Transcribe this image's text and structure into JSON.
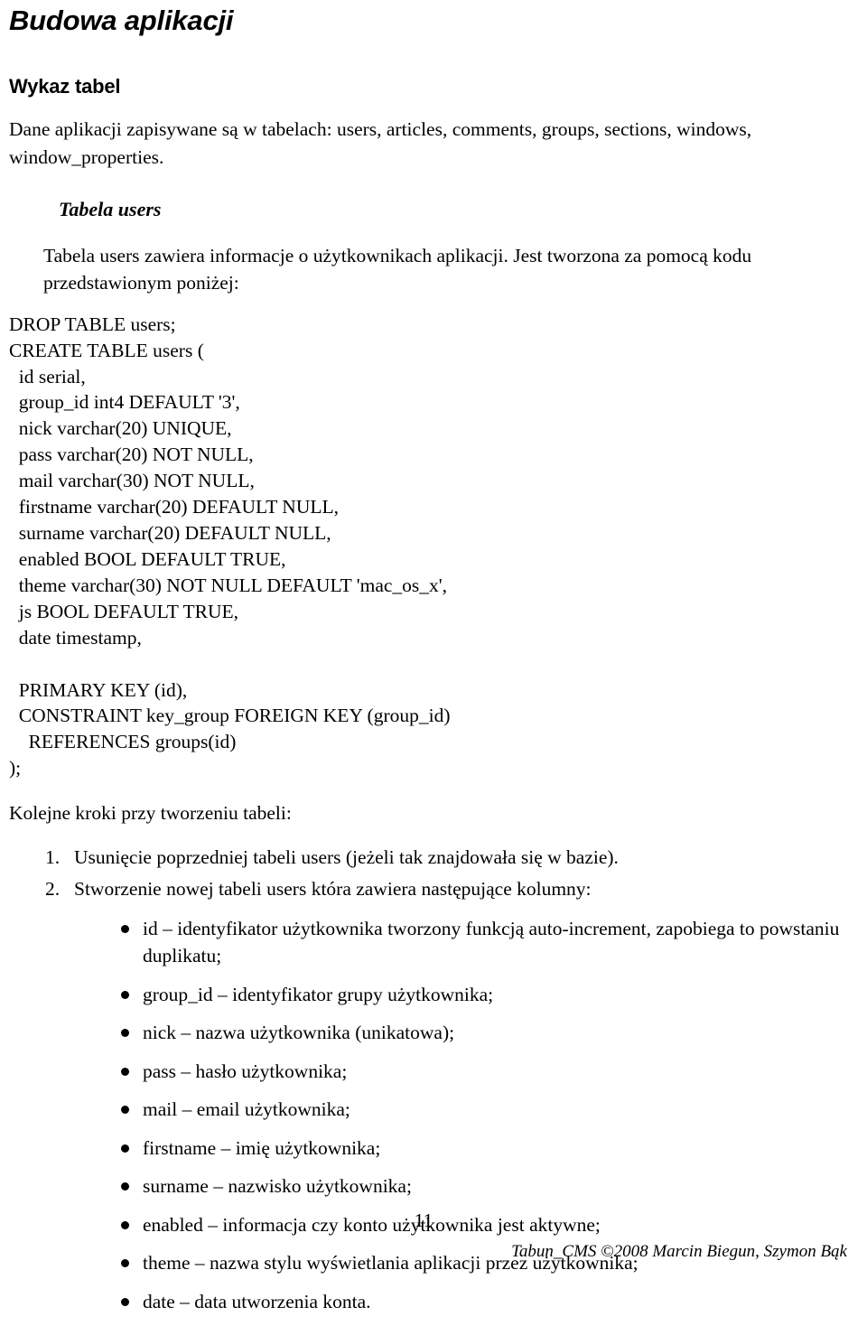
{
  "document": {
    "title": "Budowa aplikacji",
    "section_heading": "Wykaz tabel",
    "intro_paragraph": "Dane aplikacji zapisywane są w tabelach: users, articles, comments, groups, sections, windows, window_properties.",
    "subsection_heading": "Tabela users",
    "subsection_paragraph": "Tabela users zawiera informacje o użytkownikach aplikacji. Jest tworzona za pomocą kodu przedstawionym poniżej:",
    "code_lines": [
      "DROP TABLE users;",
      "CREATE TABLE users (",
      "  id serial,",
      "  group_id int4 DEFAULT '3',",
      "  nick varchar(20) UNIQUE,",
      "  pass varchar(20) NOT NULL,",
      "  mail varchar(30) NOT NULL,",
      "  firstname varchar(20) DEFAULT NULL,",
      "  surname varchar(20) DEFAULT NULL,",
      "  enabled BOOL DEFAULT TRUE,",
      "  theme varchar(30) NOT NULL DEFAULT 'mac_os_x',",
      "  js BOOL DEFAULT TRUE,",
      "  date timestamp,",
      "",
      "  PRIMARY KEY (id),",
      "  CONSTRAINT key_group FOREIGN KEY (group_id)",
      "    REFERENCES groups(id)",
      ");"
    ],
    "steps_intro": "Kolejne kroki przy tworzeniu tabeli:",
    "steps": [
      "Usunięcie poprzedniej tabeli users (jeżeli tak znajdowała się w bazie).",
      "Stworzenie nowej tabeli users która zawiera następujące kolumny:"
    ],
    "columns": [
      "id – identyfikator użytkownika tworzony funkcją auto-increment, zapobiega to powstaniu duplikatu;",
      "group_id – identyfikator grupy użytkownika;",
      "nick – nazwa użytkownika (unikatowa);",
      "pass – hasło użytkownika;",
      "mail – email użytkownika;",
      "firstname – imię użytkownika;",
      "surname – nazwisko użytkownika;",
      "enabled – informacja czy konto użytkownika jest aktywne;",
      "theme – nazwa stylu wyświetlania aplikacji przez użytkownika;",
      "date – data utworzenia konta."
    ],
    "footer": {
      "page_number": "11",
      "credit": "Tabun_CMS ©2008 Marcin Biegun, Szymon Bąk"
    }
  }
}
